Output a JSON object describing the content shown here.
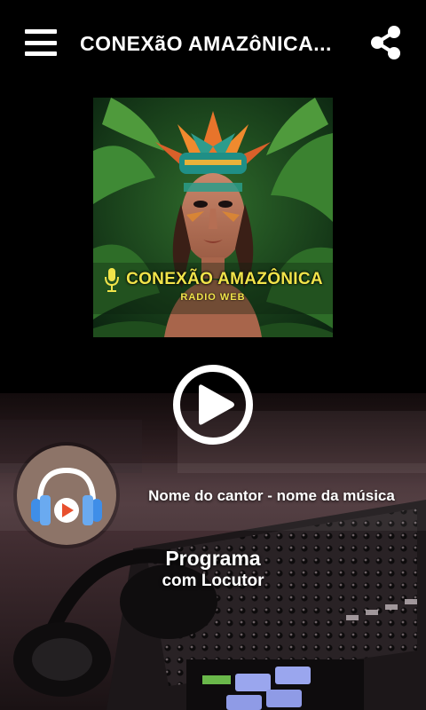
{
  "header": {
    "title": "CONEXãO AMAZôNICA...",
    "menu_icon": "hamburger-menu-icon",
    "share_icon": "share-icon"
  },
  "cover": {
    "brand_name": "CONEXÃO AMAZÔNICA",
    "brand_sub": "RADIO WEB",
    "mic_icon": "microphone-icon"
  },
  "player": {
    "play_icon": "play-icon",
    "now_playing": "Nome do cantor - nome da música",
    "avatar_icon": "headphones-play-icon"
  },
  "program": {
    "name": "Programa",
    "host": "com Locutor"
  },
  "colors": {
    "background": "#000000",
    "text": "#ffffff",
    "brand_yellow": "#f1e44a",
    "avatar_bg": "#8d7468",
    "headphone_blue": "#3f8ee8",
    "play_red": "#e8502e"
  }
}
